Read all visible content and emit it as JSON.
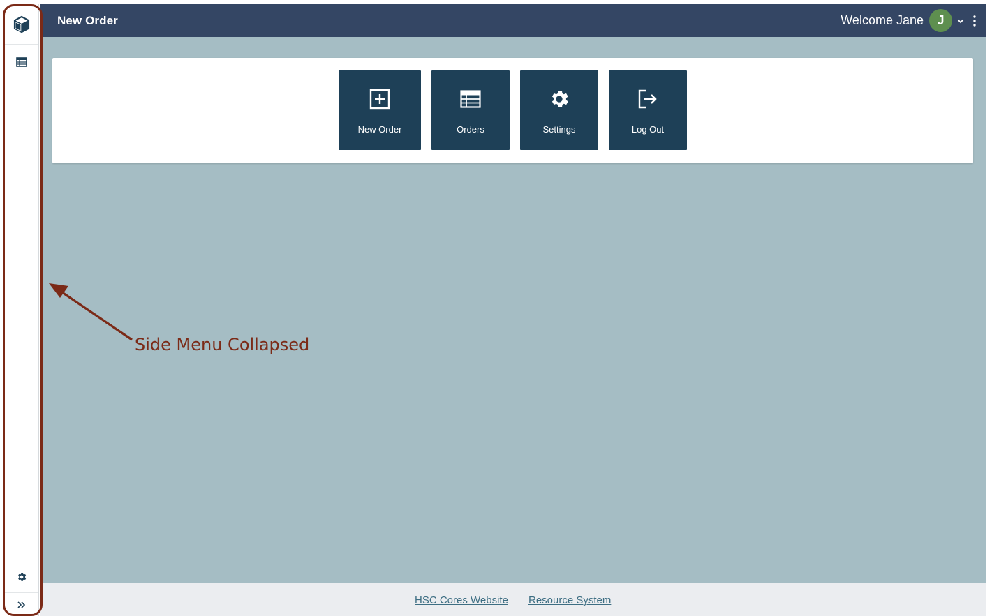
{
  "header": {
    "title": "New Order",
    "welcome": "Welcome Jane",
    "avatar_initial": "J"
  },
  "sidebar": {
    "logo_icon": "cube-icon",
    "items": [
      {
        "icon": "table-icon"
      }
    ],
    "bottom": [
      {
        "icon": "gear-icon"
      },
      {
        "icon": "double-chevron-right-icon"
      }
    ]
  },
  "tiles": [
    {
      "label": "New Order",
      "icon": "plus-square-icon"
    },
    {
      "label": "Orders",
      "icon": "table-icon"
    },
    {
      "label": "Settings",
      "icon": "gear-icon"
    },
    {
      "label": "Log Out",
      "icon": "logout-icon"
    }
  ],
  "footer": {
    "links": [
      {
        "label": "HSC Cores Website"
      },
      {
        "label": "Resource System"
      }
    ]
  },
  "annotation": {
    "text": "Side Menu Collapsed"
  },
  "colors": {
    "topbar": "#344664",
    "tile": "#1e4057",
    "main_bg": "#a5bdc4",
    "avatar": "#5e8f4f",
    "annotation": "#7b2a17",
    "link": "#3d6e83"
  }
}
